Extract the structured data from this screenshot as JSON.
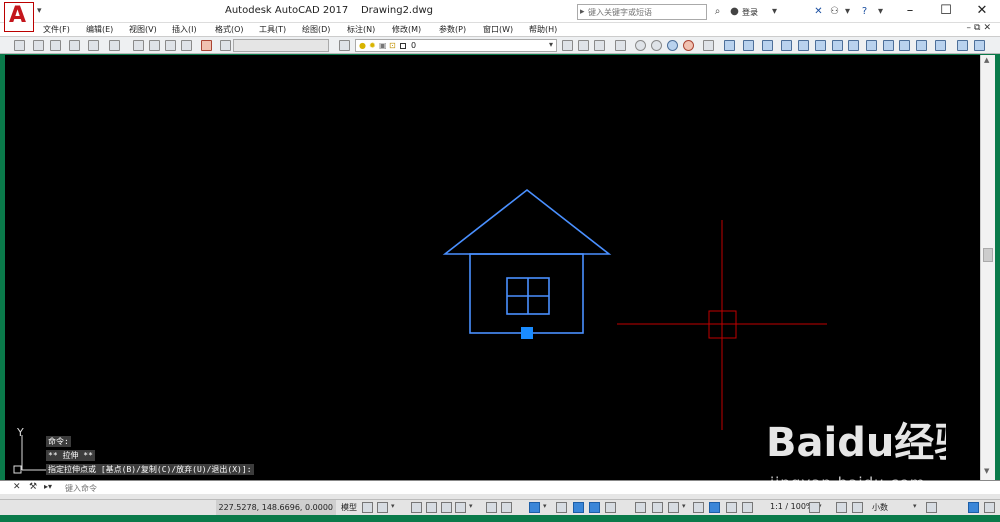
{
  "title_bar": {
    "app_logo": "A",
    "window_title": "Autodesk AutoCAD 2017    Drawing2.dwg",
    "search_placeholder": "键入关键字或短语",
    "login_label": "登录"
  },
  "menu": {
    "items": [
      "文件(F)",
      "编辑(E)",
      "视图(V)",
      "插入(I)",
      "格式(O)",
      "工具(T)",
      "绘图(D)",
      "标注(N)",
      "修改(M)",
      "参数(P)",
      "窗口(W)",
      "帮助(H)"
    ]
  },
  "toolbar": {
    "current_layer": "0"
  },
  "drawing": {
    "house_color": "#4a90ff",
    "grip_color": "#1a8cff",
    "crosshair_color": "#c00000",
    "ucs_y_label": "Y"
  },
  "command_history": [
    "命令:",
    "** 拉伸 **",
    "指定拉伸点或 [基点(B)/复制(C)/放弃(U)/退出(X)]:"
  ],
  "command_line": {
    "placeholder": "键入命令"
  },
  "status_bar": {
    "coordinates": "227.5278, 148.6696, 0.0000",
    "model_label": "模型",
    "scale_label": "1:1 / 100%",
    "units_label": "小数"
  },
  "watermark": {
    "brand": "Baidu经验",
    "url": "jingyan.baidu.com"
  }
}
